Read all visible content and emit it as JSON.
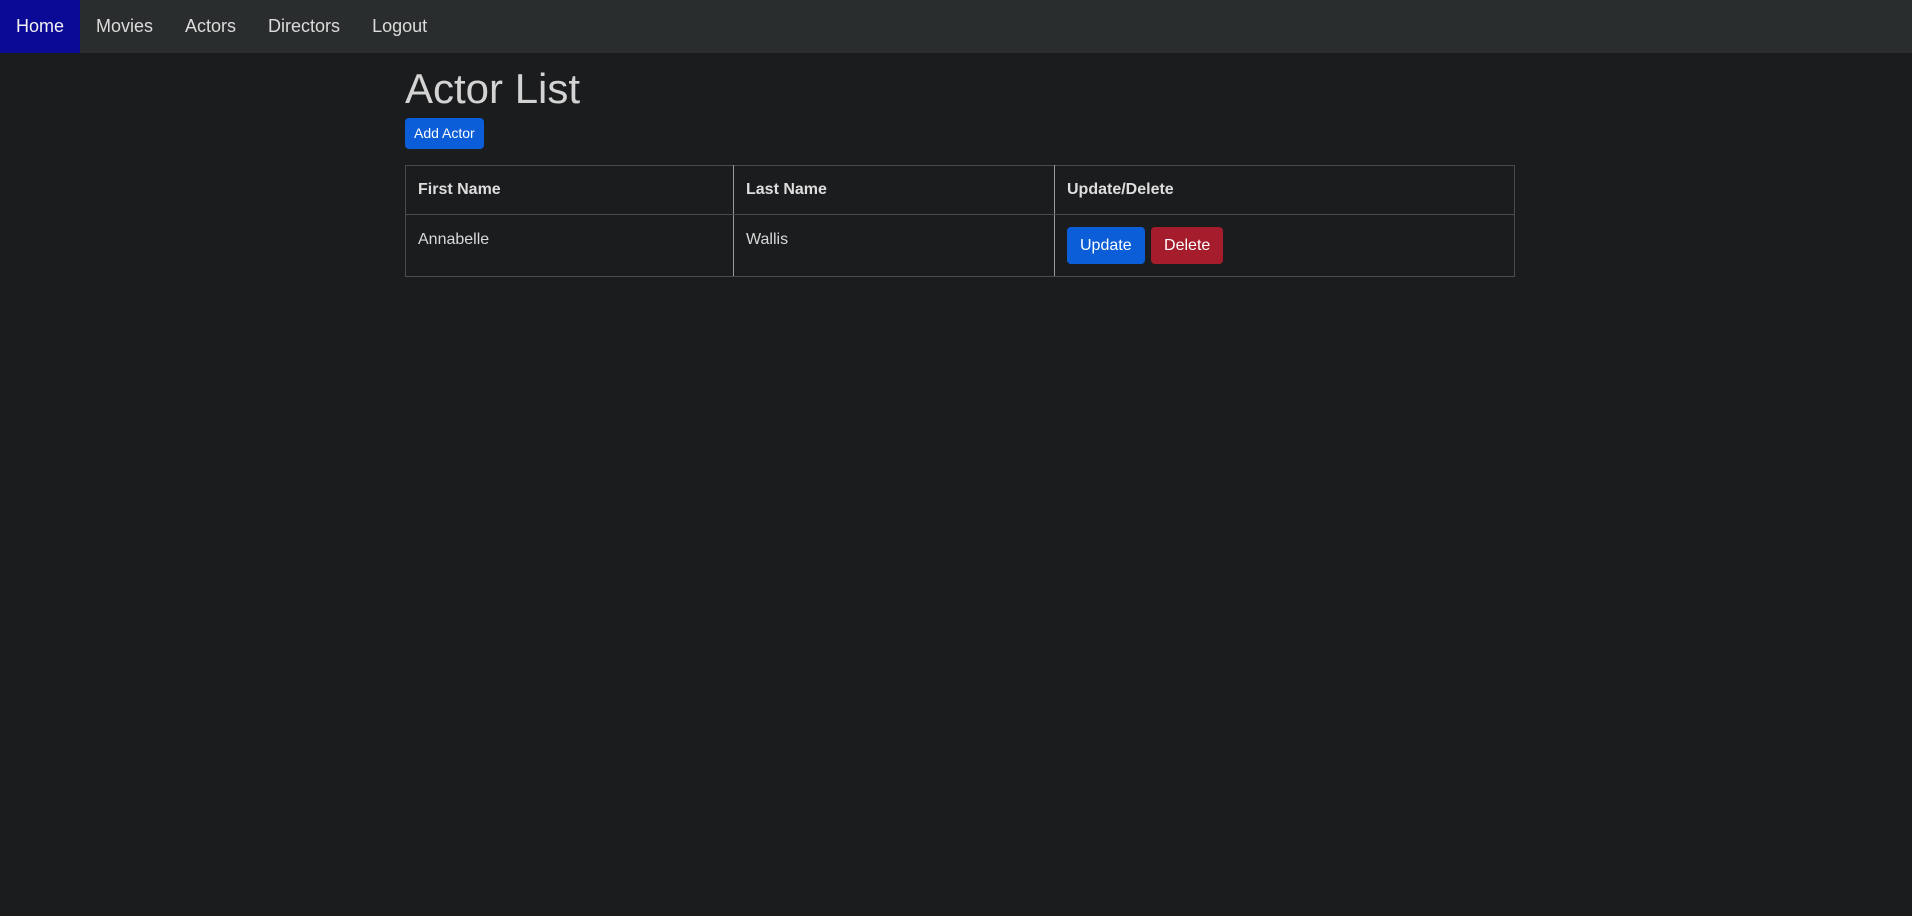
{
  "nav": {
    "items": [
      {
        "label": "Home",
        "active": true
      },
      {
        "label": "Movies",
        "active": false
      },
      {
        "label": "Actors",
        "active": false
      },
      {
        "label": "Directors",
        "active": false
      },
      {
        "label": "Logout",
        "active": false
      }
    ]
  },
  "page": {
    "title": "Actor List",
    "add_button_label": "Add Actor"
  },
  "table": {
    "headers": [
      "First Name",
      "Last Name",
      "Update/Delete"
    ],
    "rows": [
      {
        "first_name": "Annabelle",
        "last_name": "Wallis",
        "update_label": "Update",
        "delete_label": "Delete"
      }
    ]
  },
  "colors": {
    "background": "#1b1c1e",
    "navbar": "#2a2d2e",
    "nav_active": "#0a0a96",
    "primary": "#0b5ed7",
    "danger": "#a51d2d"
  }
}
